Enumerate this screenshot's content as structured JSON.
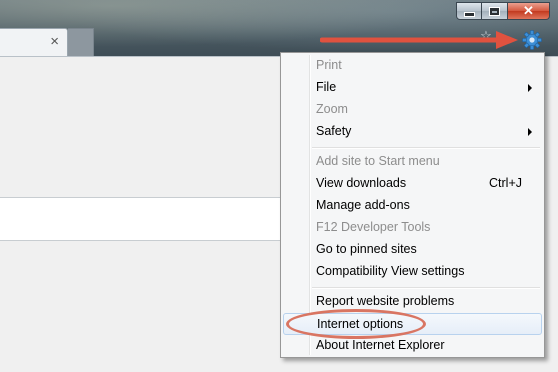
{
  "window": {
    "minimize_icon": "minimize-icon",
    "maximize_icon": "maximize-icon",
    "close_glyph": "✕",
    "close_icon": "close-icon"
  },
  "tab": {
    "close_glyph": "×"
  },
  "toolbar": {
    "favorites_icon": "star-icon",
    "tools_icon": "gear-icon",
    "gear_color": "#3d8fd6"
  },
  "annotation": {
    "arrow_color": "#e0523f",
    "ring_color": "#d97562"
  },
  "menu": {
    "items": [
      {
        "label": "Print",
        "disabled": true
      },
      {
        "label": "File",
        "submenu": true
      },
      {
        "label": "Zoom",
        "disabled": true
      },
      {
        "label": "Safety",
        "submenu": true
      },
      {
        "label": "Add site to Start menu",
        "disabled": true
      },
      {
        "label": "View downloads",
        "shortcut": "Ctrl+J"
      },
      {
        "label": "Manage add-ons"
      },
      {
        "label": "F12 Developer Tools",
        "disabled": true
      },
      {
        "label": "Go to pinned sites"
      },
      {
        "label": "Compatibility View settings"
      },
      {
        "label": "Report website problems"
      },
      {
        "label": "Internet options",
        "highlighted": true
      },
      {
        "label": "About Internet Explorer"
      }
    ]
  }
}
